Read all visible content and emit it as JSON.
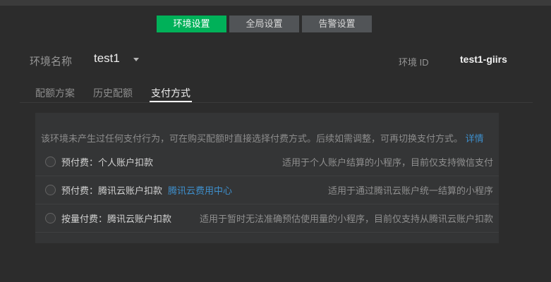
{
  "colors": {
    "page_bg": "#2c2c2c",
    "topbar_bg": "#3b3b3b",
    "panel_bg": "#343536",
    "active_tab_green": "#00b159",
    "inactive_tab_gray": "#515457",
    "link_blue": "#3e8fcc"
  },
  "top_tabs": [
    {
      "label": "环境设置",
      "active": true
    },
    {
      "label": "全局设置",
      "active": false
    },
    {
      "label": "告警设置",
      "active": false
    }
  ],
  "env_header": {
    "name_label": "环境名称",
    "name_value": "test1",
    "id_label": "环境 ID",
    "id_value": "test1-giirs"
  },
  "sub_tabs": [
    {
      "label": "配额方案",
      "active": false
    },
    {
      "label": "历史配额",
      "active": false
    },
    {
      "label": "支付方式",
      "active": true
    }
  ],
  "panel": {
    "notice": "该环境未产生过任何支付行为，可在购买配额时直接选择付费方式。后续如需调整，可再切换支付方式。",
    "notice_link": "详情",
    "options": [
      {
        "label": "预付费：个人账户扣款",
        "link": "",
        "desc": "适用于个人账户结算的小程序，目前仅支持微信支付"
      },
      {
        "label": "预付费：腾讯云账户扣款",
        "link": "腾讯云费用中心",
        "desc": "适用于通过腾讯云账户统一结算的小程序"
      },
      {
        "label": "按量付费：腾讯云账户扣款",
        "link": "",
        "desc": "适用于暂时无法准确预估使用量的小程序，目前仅支持从腾讯云账户扣款"
      }
    ]
  }
}
